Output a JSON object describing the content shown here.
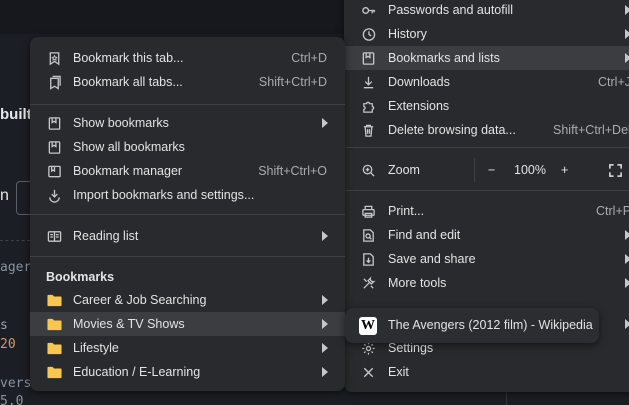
{
  "background": {
    "heading_fragment": "built",
    "pill_fragment": "n",
    "code_lines": [
      "ager",
      "s",
      "20",
      "vers",
      "5.0"
    ]
  },
  "bookmarks_menu": {
    "items": [
      {
        "label": "Bookmark this tab...",
        "shortcut": "Ctrl+D",
        "icon": "bookmark-star-icon"
      },
      {
        "label": "Bookmark all tabs...",
        "shortcut": "Shift+Ctrl+D",
        "icon": "bookmark-tabs-icon"
      },
      {
        "label": "Show bookmarks",
        "icon": "bookmark-icon"
      },
      {
        "label": "Show all bookmarks",
        "icon": "bookmarks-icon"
      },
      {
        "label": "Bookmark manager",
        "shortcut": "Shift+Ctrl+O",
        "icon": "bookmark-manager-icon"
      },
      {
        "label": "Import bookmarks and settings...",
        "icon": "import-icon"
      },
      {
        "label": "Reading list",
        "icon": "reading-list-icon"
      }
    ],
    "section_title": "Bookmarks",
    "folders": [
      {
        "label": "Career & Job Searching"
      },
      {
        "label": "Movies & TV Shows"
      },
      {
        "label": "Lifestyle"
      },
      {
        "label": "Education / E-Learning"
      }
    ]
  },
  "main_menu": {
    "items": [
      {
        "label": "Passwords and autofill",
        "icon": "key-icon"
      },
      {
        "label": "History",
        "icon": "history-icon"
      },
      {
        "label": "Bookmarks and lists",
        "icon": "bookmarks-list-icon"
      },
      {
        "label": "Downloads",
        "shortcut": "Ctrl+J",
        "icon": "download-icon"
      },
      {
        "label": "Extensions",
        "icon": "puzzle-icon"
      },
      {
        "label": "Delete browsing data...",
        "shortcut": "Shift+Ctrl+Del",
        "icon": "trash-icon"
      },
      {
        "label": "Zoom",
        "icon": "zoom-icon"
      },
      {
        "label": "Print...",
        "shortcut": "Ctrl+P",
        "icon": "printer-icon"
      },
      {
        "label": "Find and edit",
        "icon": "find-icon"
      },
      {
        "label": "Save and share",
        "icon": "save-share-icon"
      },
      {
        "label": "More tools",
        "icon": "tools-icon"
      },
      {
        "label": "Settings",
        "icon": "gear-icon"
      },
      {
        "label": "Exit",
        "icon": "close-icon"
      }
    ],
    "zoom": {
      "minus": "−",
      "value": "100%",
      "plus": "+"
    }
  },
  "folder_submenu": {
    "items": [
      {
        "label": "The Avengers (2012 film) - Wikipedia",
        "favicon": "W"
      }
    ]
  },
  "colors": {
    "menu_bg": "#292a2d",
    "highlight": "#3c3d40",
    "folder": "#f9c74f",
    "text": "#e3e3e3"
  }
}
